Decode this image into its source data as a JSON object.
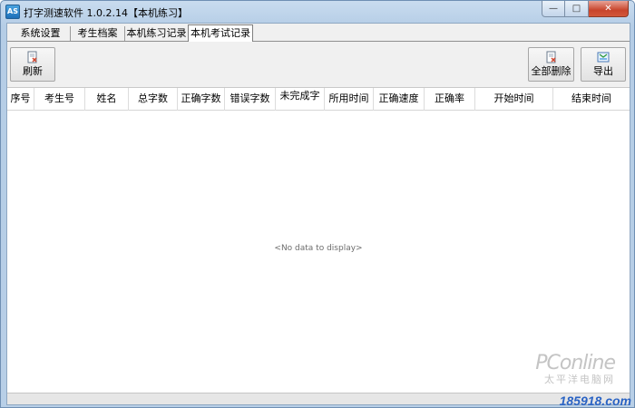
{
  "window": {
    "app_icon_text": "AS",
    "title": "打字测速软件  1.0.2.14【本机练习】",
    "min_glyph": "—",
    "max_glyph": "□",
    "close_glyph": "✕"
  },
  "tabs": [
    {
      "label": "系统设置",
      "active": false
    },
    {
      "label": "考生档案",
      "active": false
    },
    {
      "label": "本机练习记录",
      "active": false
    },
    {
      "label": "本机考试记录",
      "active": true
    }
  ],
  "toolbar": {
    "refresh_label": "刷新",
    "delete_all_label": "全部删除",
    "export_label": "导出"
  },
  "grid": {
    "columns": [
      "序号",
      "考生号",
      "姓名",
      "总字数",
      "正确字数",
      "错误字数",
      "未完成字",
      "所用时间",
      "正确速度",
      "正确率",
      "开始时间",
      "结束时间"
    ],
    "empty_text": "<No data to display>"
  },
  "watermark": {
    "logo": "PConline",
    "sub": "太平洋电脑网",
    "site": "185918.com"
  },
  "colors": {
    "title_bar": "#c9dcef",
    "close_button": "#c8452c",
    "site_text": "#2a63c4"
  }
}
